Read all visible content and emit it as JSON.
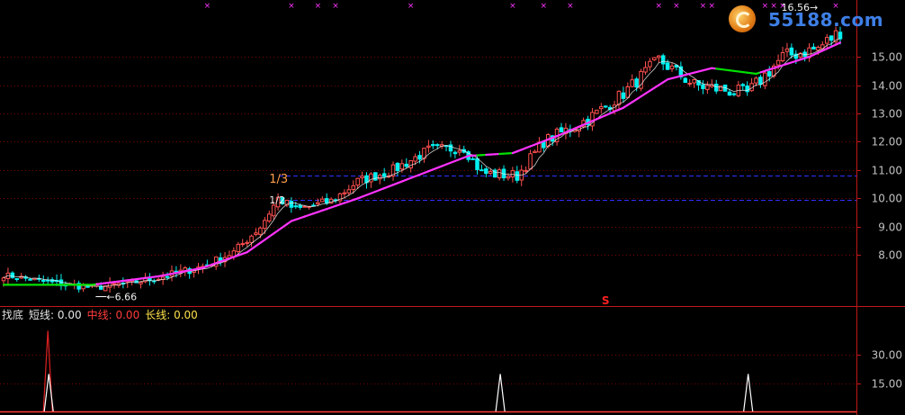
{
  "chart_data": [
    {
      "type": "candlestick",
      "title": "",
      "y_ticks": [
        "15.00",
        "14.00",
        "13.00",
        "12.00",
        "11.00",
        "10.00",
        "9.00",
        "8.00"
      ],
      "ylim": [
        6.2,
        16.75
      ],
      "n_bars": 190,
      "x_range_px_note": "",
      "guide_levels": [
        10.8,
        9.95
      ],
      "annotations": {
        "low_label": "6.66",
        "high_label": "16.56",
        "fraction_1": "1/3",
        "fraction_2": "1/2",
        "signal_mark": "S"
      },
      "close_anchors": [
        [
          0,
          7.3
        ],
        [
          12,
          7.0
        ],
        [
          20,
          6.85
        ],
        [
          28,
          7.0
        ],
        [
          35,
          7.2
        ],
        [
          45,
          7.6
        ],
        [
          52,
          8.1
        ],
        [
          58,
          9.0
        ],
        [
          62,
          10.0
        ],
        [
          66,
          9.6
        ],
        [
          74,
          9.9
        ],
        [
          80,
          10.6
        ],
        [
          88,
          11.0
        ],
        [
          96,
          11.7
        ],
        [
          104,
          11.8
        ],
        [
          108,
          10.9
        ],
        [
          116,
          10.8
        ],
        [
          122,
          12.0
        ],
        [
          132,
          12.8
        ],
        [
          140,
          13.7
        ],
        [
          148,
          14.9
        ],
        [
          156,
          14.0
        ],
        [
          164,
          13.8
        ],
        [
          168,
          13.7
        ],
        [
          176,
          15.0
        ],
        [
          184,
          15.3
        ],
        [
          189,
          15.9
        ]
      ],
      "ma_mid_anchors": [
        [
          0,
          7.2
        ],
        [
          20,
          7.0
        ],
        [
          40,
          7.4
        ],
        [
          55,
          8.4
        ],
        [
          70,
          9.6
        ],
        [
          90,
          10.8
        ],
        [
          105,
          11.4
        ],
        [
          115,
          11.0
        ],
        [
          125,
          11.7
        ],
        [
          140,
          13.0
        ],
        [
          152,
          14.5
        ],
        [
          160,
          14.4
        ],
        [
          170,
          14.2
        ],
        [
          185,
          15.1
        ],
        [
          189,
          15.5
        ]
      ],
      "ma_long_anchors": [
        [
          0,
          6.95
        ],
        [
          20,
          6.95
        ],
        [
          35,
          7.25
        ],
        [
          45,
          7.55
        ],
        [
          55,
          8.1
        ],
        [
          65,
          9.2
        ],
        [
          80,
          10.0
        ],
        [
          95,
          10.9
        ],
        [
          105,
          11.5
        ],
        [
          115,
          11.6
        ],
        [
          125,
          12.2
        ],
        [
          140,
          13.2
        ],
        [
          150,
          14.2
        ],
        [
          160,
          14.6
        ],
        [
          170,
          14.4
        ],
        [
          182,
          15.0
        ],
        [
          189,
          15.5
        ]
      ],
      "top_signal_bars": [
        46,
        65,
        71,
        75,
        92,
        115,
        122,
        128,
        148,
        152,
        158,
        160,
        172,
        174,
        176,
        188
      ]
    },
    {
      "type": "line",
      "title": "找底",
      "legend": [
        {
          "name": "短线",
          "value": "0.00",
          "color": "#e6e6e6"
        },
        {
          "name": "中线",
          "value": "0.00",
          "color": "#ff3b3b"
        },
        {
          "name": "长线",
          "value": "0.00",
          "color": "#ffe14a"
        }
      ],
      "y_ticks": [
        "30.00",
        "15.00"
      ],
      "ylim": [
        0,
        50
      ],
      "spikes": [
        {
          "bar": 10,
          "white": 20,
          "red": 42
        },
        {
          "bar": 112,
          "white": 20,
          "red": 0
        },
        {
          "bar": 168,
          "white": 20,
          "red": 0
        }
      ]
    }
  ],
  "colors": {
    "up": "#ff4f4f",
    "down": "#00f0f0",
    "ma_mid": "#ff33ff",
    "ma_short": "#f0f0f0",
    "ma_long_neutral": "#00e100",
    "grid": "#8b0000",
    "guide": "#3030ff",
    "axis_text": "#c0c0c0",
    "annotation": "#ff9f4a",
    "signal": "#ff33ff"
  },
  "watermark": {
    "text": "55188.com",
    "icon": "logo-swirl-icon"
  }
}
